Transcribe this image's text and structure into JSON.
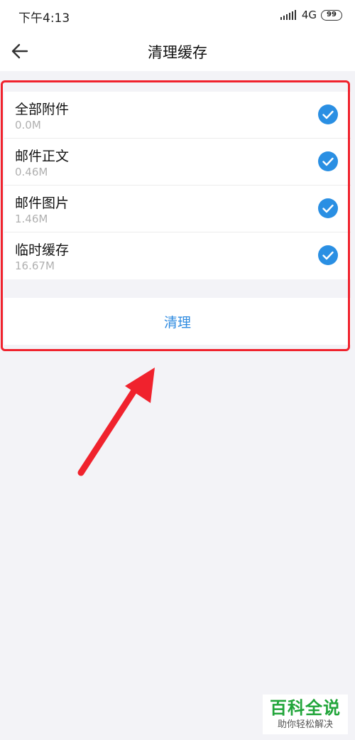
{
  "status_bar": {
    "time": "下午4:13",
    "network": "4G",
    "battery": "99"
  },
  "header": {
    "title": "清理缓存",
    "back_icon": "arrow-left-icon"
  },
  "cache_items": [
    {
      "label": "全部附件",
      "size": "0.0M",
      "checked": true
    },
    {
      "label": "邮件正文",
      "size": "0.46M",
      "checked": true
    },
    {
      "label": "邮件图片",
      "size": "1.46M",
      "checked": true
    },
    {
      "label": "临时缓存",
      "size": "16.67M",
      "checked": true
    }
  ],
  "actions": {
    "clean_label": "清理"
  },
  "watermark": {
    "title": "百科全说",
    "subtitle": "助你轻松解决"
  },
  "colors": {
    "accent": "#2f8be0",
    "check": "#2a8fe3",
    "highlight": "#f0222d",
    "watermark": "#21a53a"
  }
}
